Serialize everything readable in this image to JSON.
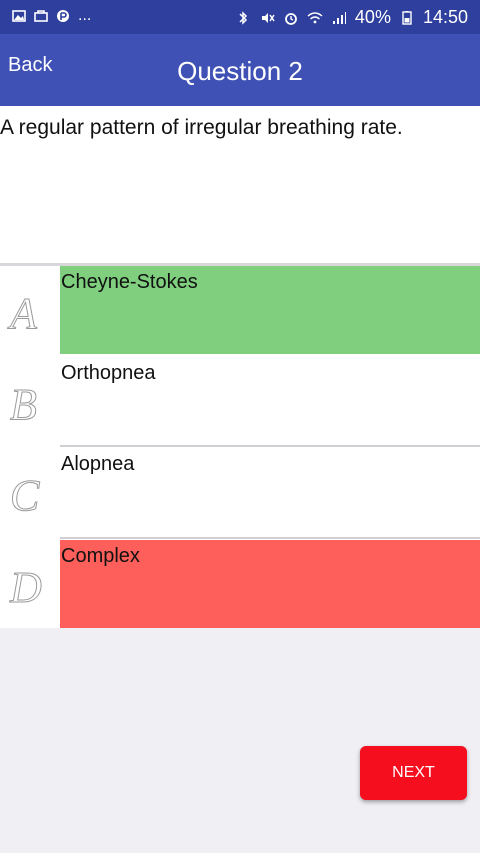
{
  "status_bar": {
    "left_icons": [
      "gallery-icon",
      "bag-icon",
      "parking-icon",
      "more-dots"
    ],
    "more_text": "...",
    "battery_text": "40%",
    "time": "14:50"
  },
  "header": {
    "back_label": "Back",
    "title": "Question 2"
  },
  "question": {
    "text": "A regular pattern of irregular breathing rate."
  },
  "answers": [
    {
      "letter": "A",
      "label": "Cheyne-Stokes",
      "state": "correct",
      "color": "#7fcf7f"
    },
    {
      "letter": "B",
      "label": "Orthopnea",
      "state": "neutral",
      "color": "#ffffff"
    },
    {
      "letter": "C",
      "label": "Alopnea",
      "state": "neutral",
      "color": "#ffffff"
    },
    {
      "letter": "D",
      "label": "Complex",
      "state": "incorrect",
      "color": "#ff5f5a"
    }
  ],
  "footer": {
    "next_label": "NEXT"
  },
  "colors": {
    "status_bar": "#2f3f9e",
    "app_bar": "#3f51b5",
    "background": "#efeff4",
    "next_button": "#f50f1e"
  }
}
